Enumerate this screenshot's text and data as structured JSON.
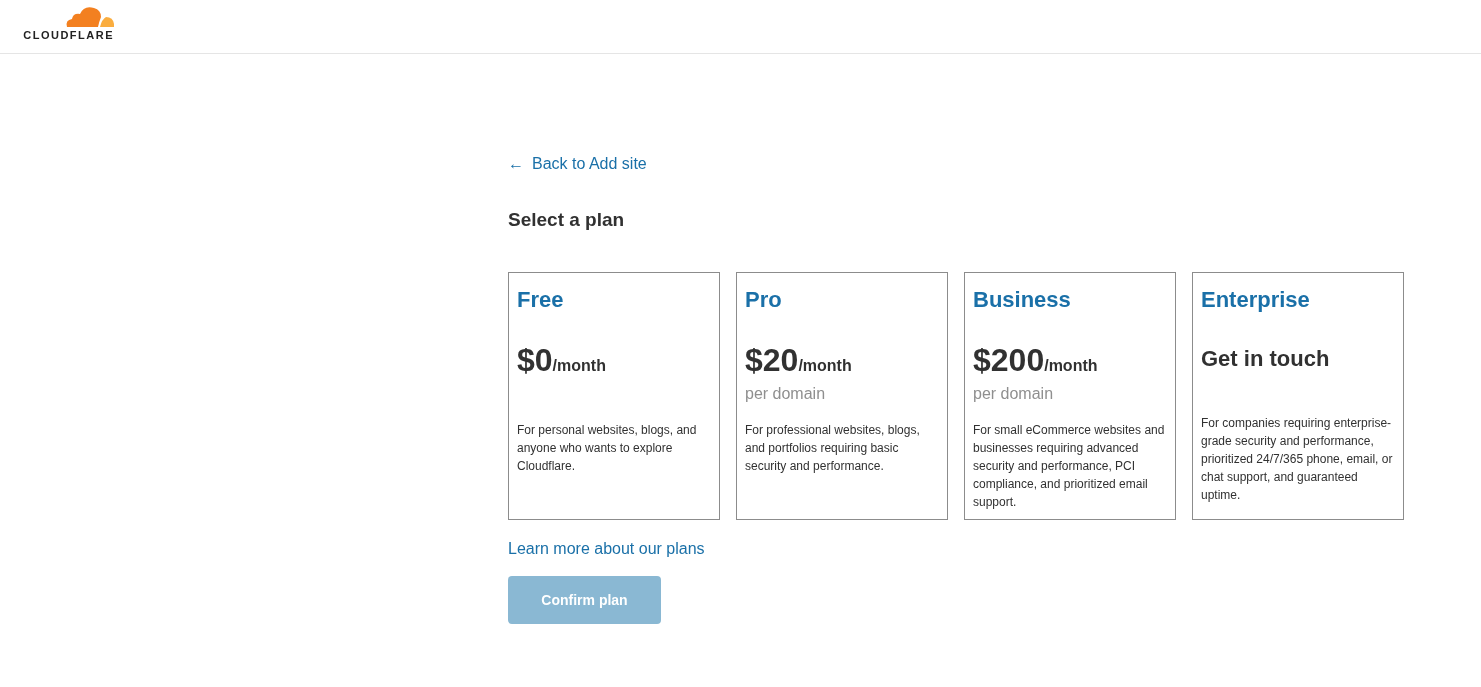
{
  "header": {
    "logo_text": "CLOUDFLARE"
  },
  "back_link": {
    "arrow": "←",
    "label": "Back to Add site"
  },
  "heading": "Select a plan",
  "plans": [
    {
      "kind": "price",
      "name": "Free",
      "selected": false,
      "price": "$0",
      "period": "/month",
      "description": "For personal websites, blogs, and anyone who wants to explore Cloudflare."
    },
    {
      "kind": "price",
      "name": "Pro",
      "selected": false,
      "price": "$20",
      "period": "/month",
      "note": "per domain",
      "description": "For professional websites, blogs, and portfolios requiring basic security and performance."
    },
    {
      "kind": "price",
      "name": "Business",
      "selected": false,
      "price": "$200",
      "period": "/month",
      "note": "per domain",
      "description": "For small eCommerce websites and businesses requiring advanced security and performance, PCI compliance, and prioritized email support."
    },
    {
      "kind": "contact",
      "name": "Enterprise",
      "selected": false,
      "contact": "Get in touch",
      "description": "For companies requiring enterprise-grade security and performance, prioritized 24/7/365 phone, email, or chat support, and guaranteed uptime."
    }
  ],
  "learn_more": "Learn more about our plans",
  "confirm_button": {
    "label": "Confirm plan",
    "disabled": true
  }
}
